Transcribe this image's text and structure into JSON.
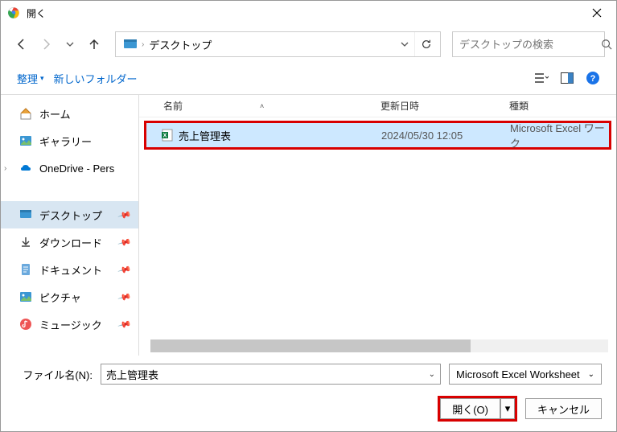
{
  "title": "開く",
  "breadcrumb": "デスクトップ",
  "search_placeholder": "デスクトップの検索",
  "toolbar": {
    "organize": "整理",
    "new_folder": "新しいフォルダー"
  },
  "sidebar": {
    "home": "ホーム",
    "gallery": "ギャラリー",
    "onedrive": "OneDrive - Pers",
    "desktop": "デスクトップ",
    "downloads": "ダウンロード",
    "documents": "ドキュメント",
    "pictures": "ピクチャ",
    "music": "ミュージック"
  },
  "columns": {
    "name": "名前",
    "date": "更新日時",
    "type": "種類"
  },
  "files": [
    {
      "name": "売上管理表",
      "date": "2024/05/30 12:05",
      "type": "Microsoft Excel ワーク"
    }
  ],
  "filename_label": "ファイル名(N):",
  "filename_value": "売上管理表",
  "filter": "Microsoft Excel Worksheet",
  "buttons": {
    "open": "開く(O)",
    "cancel": "キャンセル"
  }
}
